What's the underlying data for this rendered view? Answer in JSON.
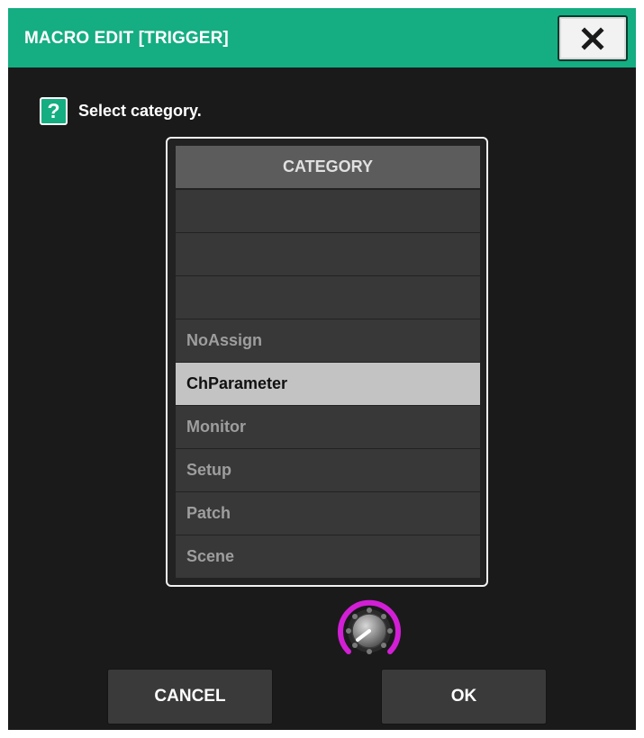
{
  "dialog": {
    "title": "MACRO EDIT [TRIGGER]",
    "close_icon": "close-x-icon"
  },
  "help": {
    "icon": "?",
    "text": "Select category."
  },
  "category_list": {
    "header": "CATEGORY",
    "items": [
      {
        "label": "",
        "selected": false
      },
      {
        "label": "",
        "selected": false
      },
      {
        "label": "",
        "selected": false
      },
      {
        "label": "NoAssign",
        "selected": false
      },
      {
        "label": "ChParameter",
        "selected": true
      },
      {
        "label": "Monitor",
        "selected": false
      },
      {
        "label": "Setup",
        "selected": false
      },
      {
        "label": "Patch",
        "selected": false
      },
      {
        "label": "Scene",
        "selected": false
      }
    ]
  },
  "knob": {
    "icon": "rotary-encoder-icon",
    "ring_color": "#d21fd6"
  },
  "buttons": {
    "cancel_label": "CANCEL",
    "ok_label": "OK"
  },
  "colors": {
    "accent": "#15ad82",
    "background": "#1a1a1a",
    "selected_row": "#c3c3c3"
  }
}
